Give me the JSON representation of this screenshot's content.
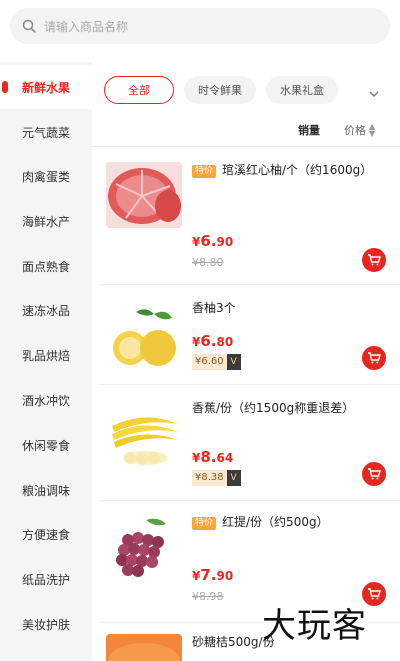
{
  "search": {
    "placeholder": "请输入商品名称"
  },
  "sidebar": {
    "items": [
      {
        "label": "新鲜水果",
        "active": true
      },
      {
        "label": "元气蔬菜"
      },
      {
        "label": "肉禽蛋类"
      },
      {
        "label": "海鲜水产"
      },
      {
        "label": "面点熟食"
      },
      {
        "label": "速冻冰品"
      },
      {
        "label": "乳品烘焙"
      },
      {
        "label": "酒水冲饮"
      },
      {
        "label": "休闲零食"
      },
      {
        "label": "粮油调味"
      },
      {
        "label": "方便速食"
      },
      {
        "label": "纸品洗护"
      },
      {
        "label": "美妆护肤"
      }
    ]
  },
  "filters": {
    "chips": [
      {
        "label": "全部",
        "active": true
      },
      {
        "label": "时令鲜果"
      },
      {
        "label": "水果礼盒"
      }
    ]
  },
  "sort": {
    "sales": "销量",
    "price": "价格"
  },
  "products": [
    {
      "badge": "特价",
      "name": "琯溪红心柚/个（约1600g）",
      "price_yen": "¥",
      "price_int": "6.",
      "price_dec": "90",
      "old_price": "¥8.80"
    },
    {
      "badge": "",
      "name": "香柚3个",
      "price_yen": "¥",
      "price_int": "6.",
      "price_dec": "80",
      "vip_price": "¥6.60",
      "vip_tag": "V"
    },
    {
      "badge": "",
      "name": "香蕉/份（约1500g称重退差）",
      "price_yen": "¥",
      "price_int": "8.",
      "price_dec": "64",
      "vip_price": "¥8.38",
      "vip_tag": "V"
    },
    {
      "badge": "特价",
      "name": "红提/份（约500g）",
      "price_yen": "¥",
      "price_int": "7.",
      "price_dec": "90",
      "old_price": "¥8.98"
    },
    {
      "badge": "",
      "name": "砂糖桔500g/份"
    }
  ],
  "watermark": "大玩客",
  "colors": {
    "accent": "#e8261f",
    "badge": "#ffa437",
    "sidebar_bg": "#f5f5f5"
  }
}
